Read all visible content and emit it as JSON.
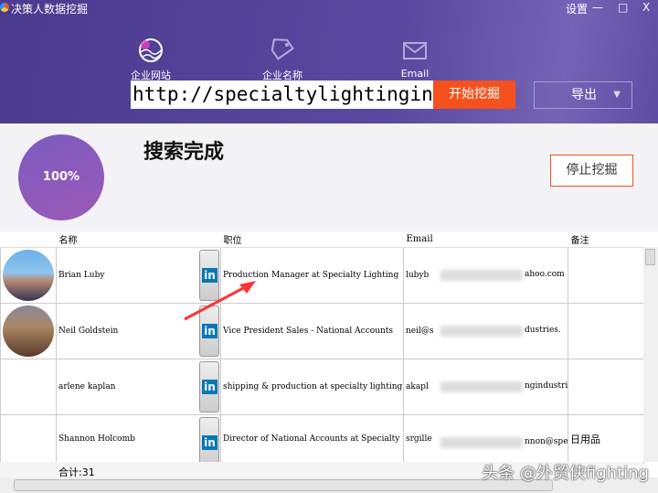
{
  "app": {
    "title": "决策人数据挖掘",
    "settings": "设置",
    "minimize": "—",
    "maximize": "□",
    "close": "X"
  },
  "tabs": [
    {
      "label": "企业网站",
      "icon": "globe-icon"
    },
    {
      "label": "企业名称",
      "icon": "tag-icon"
    },
    {
      "label": "Email",
      "icon": "mail-icon"
    }
  ],
  "search": {
    "value": "http://specialtylightingindustries.com",
    "start": "开始挖掘",
    "export": "导出",
    "export_caret": "▼"
  },
  "status": {
    "progress_label": "100%",
    "progress": 100,
    "message": "搜索完成",
    "stop": "停止挖掘"
  },
  "table": {
    "headers": [
      "名称",
      "职位",
      "Email",
      "备注"
    ],
    "rows": [
      {
        "name": "Brian Luby",
        "title": "Production Manager at Specialty Lighting",
        "email": "lubyb",
        "email_end": "ahoo.com",
        "note": ""
      },
      {
        "name": "Neil Goldstein",
        "title": "Vice President Sales - National Accounts",
        "email": "neil@s",
        "email_end": "dustries.",
        "note": ""
      },
      {
        "name": "arlene kaplan",
        "title": "shipping & production at specialty lighting",
        "email": "akapl",
        "email_end": "ngindustri",
        "note": ""
      },
      {
        "name": "Shannon Holcomb",
        "title": "Director of National Accounts at Specialty",
        "email": "srgille",
        "email_end": "nnon@spe",
        "note": "日用品"
      }
    ],
    "linkedin": "in",
    "total": "合计:31"
  },
  "watermark": "头条 @外贸侠fighting"
}
